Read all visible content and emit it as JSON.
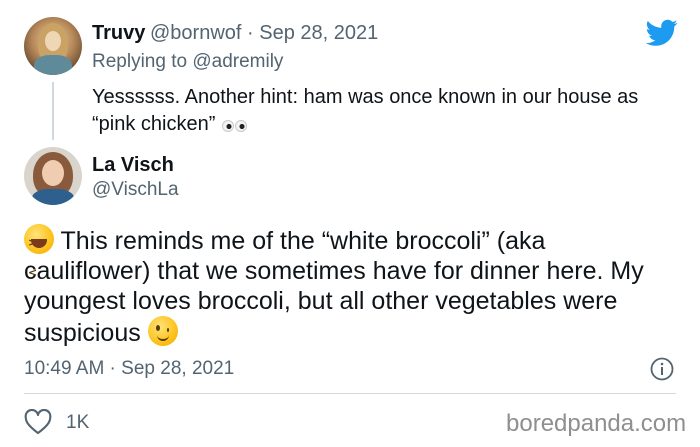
{
  "reply_tweet": {
    "name": "Truvy",
    "handle_date": "@bornwof · Sep 28, 2021",
    "replying_prefix": "Replying to",
    "replying_to": "@adremily",
    "text": "Yessssss. Another hint: ham was once known in our house as “pink chicken”",
    "emoji": "eyes-icon"
  },
  "main_tweet": {
    "name": "La Visch",
    "handle": "@VischLa",
    "lead_emoji": "laughing-face-icon",
    "text": "This reminds me of the “white broccoli” (aka cauliflower) that we sometimes have for dinner here. My youngest loves broccoli, but all other vegetables were suspicious",
    "trail_emoji": "winking-face-icon",
    "timestamp": "10:49 AM · Sep 28, 2021",
    "likes": "1K"
  },
  "watermark": "boredpanda.com",
  "colors": {
    "twitter_blue": "#1d9bf0",
    "secondary_text": "#536471",
    "divider": "#cfd9de"
  }
}
